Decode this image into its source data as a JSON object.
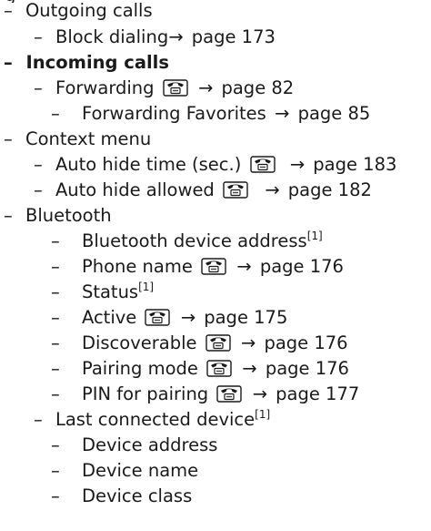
{
  "cut_text": "g",
  "items": [
    {
      "dash": "–",
      "label": "Outgoing calls"
    },
    {
      "dash": "–",
      "label": "Block dialing",
      "ref": "page 173"
    },
    {
      "dash": "–",
      "label": "Incoming calls"
    },
    {
      "dash": "–",
      "label": "Forwarding",
      "ref": "page 82"
    },
    {
      "dash": "–",
      "label": "Forwarding Favorites",
      "ref": "page 85"
    },
    {
      "dash": "–",
      "label": "Context menu"
    },
    {
      "dash": "–",
      "label": "Auto hide time (sec.)",
      "ref": "page 183"
    },
    {
      "dash": "–",
      "label": "Auto hide allowed",
      "ref": "page 182"
    },
    {
      "dash": "–",
      "label": "Bluetooth"
    },
    {
      "dash": "–",
      "label": "Bluetooth device address",
      "note": "[1]"
    },
    {
      "dash": "–",
      "label": "Phone name",
      "ref": "page 176"
    },
    {
      "dash": "–",
      "label": "Status",
      "note": "[1]"
    },
    {
      "dash": "–",
      "label": "Active",
      "ref": "page 175"
    },
    {
      "dash": "–",
      "label": "Discoverable",
      "ref": "page 176"
    },
    {
      "dash": "–",
      "label": "Pairing mode",
      "ref": "page 176"
    },
    {
      "dash": "–",
      "label": "PIN for pairing",
      "ref": "page 177"
    },
    {
      "dash": "–",
      "label": "Last connected device",
      "note": "[1]"
    },
    {
      "dash": "–",
      "label": "Device address"
    },
    {
      "dash": "–",
      "label": "Device name"
    },
    {
      "dash": "–",
      "label": "Device class"
    }
  ],
  "arrow_glyph": "→",
  "icon": "desk-phone-icon"
}
